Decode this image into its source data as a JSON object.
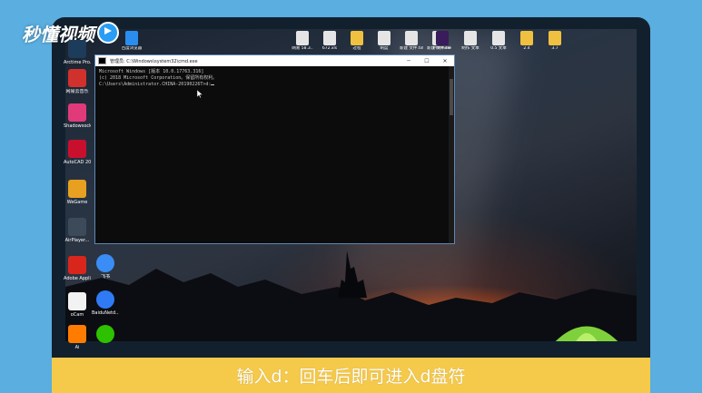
{
  "watermark": {
    "brand": "秒懂视频"
  },
  "desktop_top_icons": [
    {
      "label": "",
      "color": "#e9e9e9"
    },
    {
      "label": "百度浏览器",
      "color": "#2a8df0"
    },
    {
      "label": "网易 58.3..",
      "color": "#e5e5e5"
    },
    {
      "label": "672.xls",
      "color": "#e5e5e5"
    },
    {
      "label": "过程",
      "color": "#f0c040"
    },
    {
      "label": "制度",
      "color": "#e5e5e5"
    },
    {
      "label": "新建 文件.txt",
      "color": "#e5e5e5"
    },
    {
      "label": "新建 文件.txt",
      "color": "#e5e5e5"
    },
    {
      "label": "Premiere",
      "color": "#3a1b5c"
    },
    {
      "label": "制作 文本",
      "color": "#e5e5e5"
    },
    {
      "label": "0.5 文本",
      "color": "#e5e5e5"
    },
    {
      "label": "2.4",
      "color": "#f0c040"
    },
    {
      "label": "3.7",
      "color": "#f0c040"
    }
  ],
  "desktop_left_icons": [
    {
      "label": "Arctime Pro.exe",
      "color": "#1d3b5a"
    },
    {
      "label": "网易云音乐",
      "color": "#d0312d"
    },
    {
      "label": "ShadowsocksR",
      "color": "#e03a7a"
    },
    {
      "label": "AutoCAD 2017 - 简...",
      "color": "#c8102e"
    },
    {
      "label": "WeGame",
      "color": "#e8a020"
    },
    {
      "label": "AirPlayer...",
      "color": "#3d4a5a"
    },
    {
      "label": "Adobe Applicati...",
      "color": "#d9261c"
    },
    {
      "label": "oCam",
      "color": "#f2f2f2"
    },
    {
      "label": "Ai",
      "color": "#ff7c00"
    }
  ],
  "desktop_second_column_icons": [
    {
      "label": "飞书",
      "color": "#3a8df5"
    },
    {
      "label": "BaiduNetd...",
      "color": "#2f7bf5"
    },
    {
      "label": "",
      "color": "#2dc100"
    }
  ],
  "cmd_window": {
    "title": "管理员: C:\\Windows\\system32\\cmd.exe",
    "minimize": "─",
    "maximize": "☐",
    "close": "✕",
    "lines": [
      "Microsoft Windows [版本 10.0.17763.316]",
      "(c) 2018 Microsoft Corporation。保留所有权利。",
      "",
      "C:\\Users\\Administrator.CHINA-20190226T>d:"
    ]
  },
  "caption": {
    "text": "输入d：回车后即可进入d盘符"
  },
  "colors": {
    "outer_background": "#5aaee0",
    "caption_bar": "#f5c94a",
    "cmd_background": "#0c0c0c",
    "cmd_text": "#c7c7c7"
  }
}
